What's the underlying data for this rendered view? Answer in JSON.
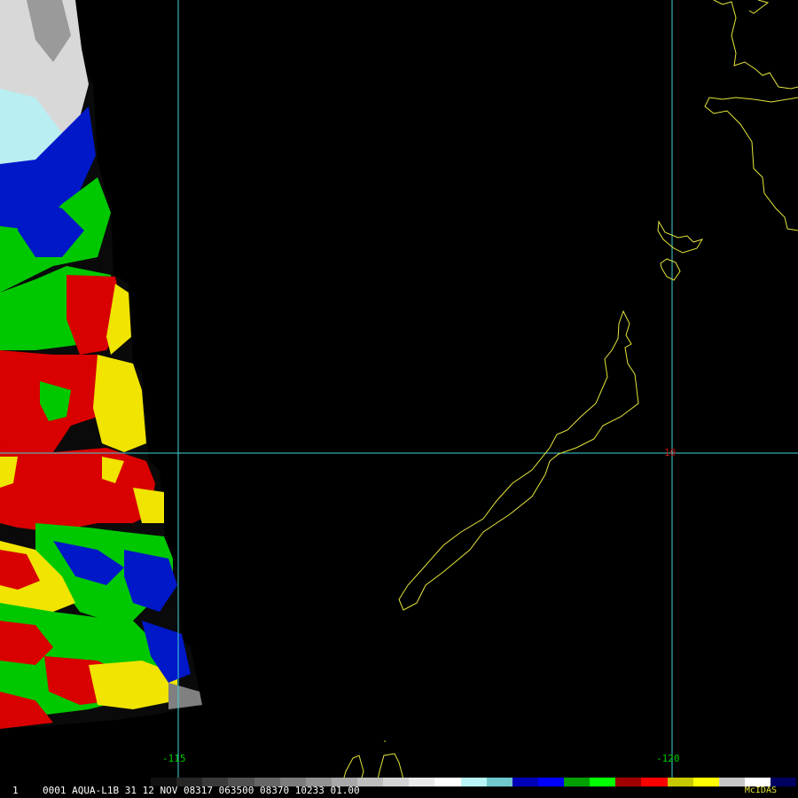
{
  "map": {
    "background_color": "#000000",
    "grid_color": "#3fd3d8",
    "coastline_color": "#e6e63a",
    "longitude_labels": [
      {
        "text": "-115",
        "color": "#00cc00"
      },
      {
        "text": "-120",
        "color": "#00cc00"
      }
    ],
    "latitude_labels": [
      {
        "text": "10",
        "color": "#cc1111"
      }
    ],
    "imagery_palette": [
      "#e8e8e8",
      "#9adfe6",
      "#0018c8",
      "#00d000",
      "#d80000",
      "#f0e400",
      "#808080"
    ]
  },
  "status_bar": {
    "frame_number": "1",
    "image_info": "0001 AQUA-L1B  31 12 NOV 08317 063500 08370 10233 01.00",
    "brand": "McIDAS",
    "color_bar": [
      "#101010",
      "#262626",
      "#3a3a3a",
      "#505050",
      "#666666",
      "#7c7c7c",
      "#929292",
      "#a8a8a8",
      "#bebebe",
      "#d4d4d4",
      "#eaeaea",
      "#ffffff",
      "#b8f4f8",
      "#70c8cc",
      "#0000b8",
      "#0000ff",
      "#00a000",
      "#00ff00",
      "#a00000",
      "#ff0000",
      "#c8c800",
      "#ffff00",
      "#c8c8c8",
      "#ffffff",
      "#000060"
    ]
  }
}
